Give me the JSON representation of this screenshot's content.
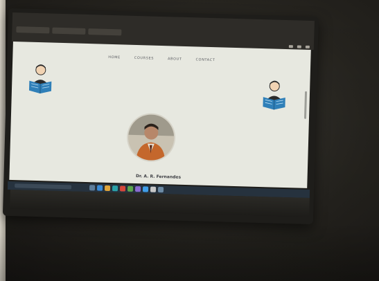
{
  "photo": {
    "background_color": "#2a2722"
  },
  "desktop": {
    "tabs": [
      "",
      "",
      ""
    ]
  },
  "website": {
    "nav": [
      "HOME",
      "COURSES",
      "ABOUT",
      "CONTACT"
    ],
    "person_name": "Dr. A. R. Fernandes",
    "icons": {
      "left": "reading-student-icon",
      "right": "reading-student-icon"
    },
    "colors": {
      "page_bg": "#e7e8e0",
      "icon_blue": "#2f7fb8"
    }
  },
  "taskbar": {
    "clock": ""
  }
}
